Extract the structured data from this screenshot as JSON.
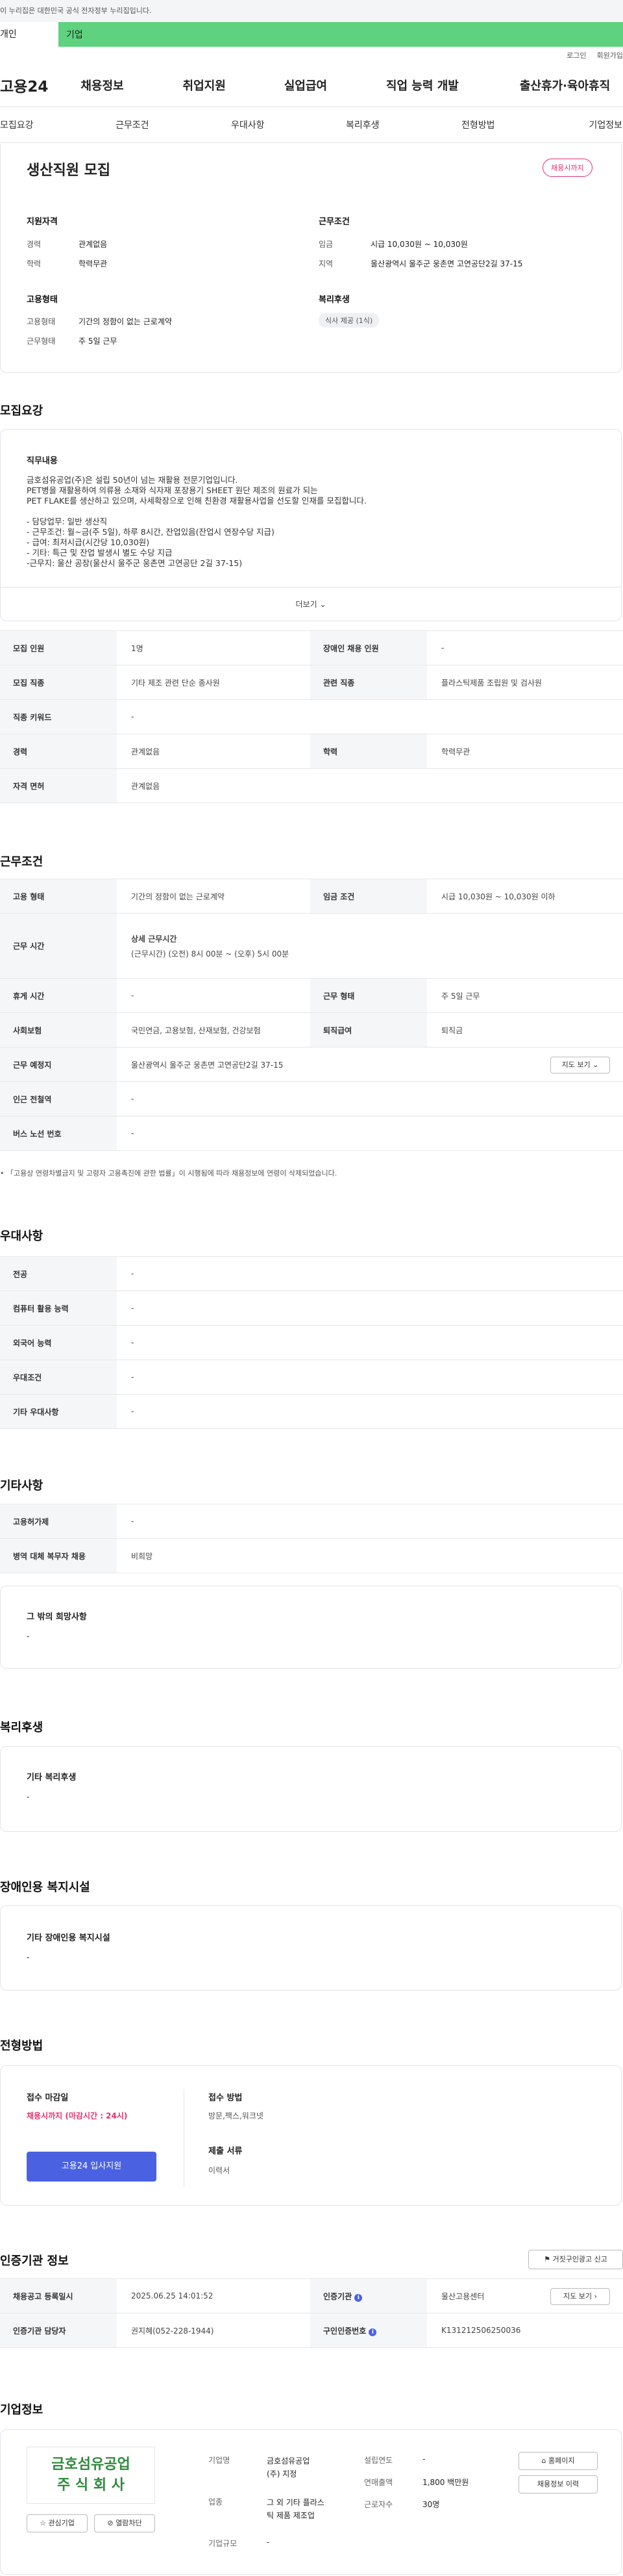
{
  "gov_notice": "이 누리집은 대한민국 공식 전자정부 누리집입니다.",
  "tabs": {
    "person": "개인",
    "company": "기업"
  },
  "util": {
    "login": "로그인",
    "join": "회원가입"
  },
  "gnb": {
    "logo": "고용24",
    "items": [
      "채용정보",
      "취업지원",
      "실업급여",
      "직업 능력 개발",
      "출산휴가·육아휴직"
    ]
  },
  "subnav": [
    "모집요강",
    "근무조건",
    "우대사항",
    "복리후생",
    "전형방법",
    "기업정보"
  ],
  "summary": {
    "title": "생산직원 모집",
    "badge": "채용시까지",
    "qual_title": "지원자격",
    "career_label": "경력",
    "career": "관계없음",
    "edu_label": "학력",
    "edu": "학력무관",
    "cond_title": "근무조건",
    "wage_label": "임금",
    "wage": "시급 10,030원 ~ 10,030원",
    "region_label": "지역",
    "region": "울산광역시 울주군 웅촌면 고연공단2길 37-15",
    "emp_title": "고용형태",
    "emp_label": "고용형태",
    "emp": "기간의 정함이 없는 근로계약",
    "work_label": "근무형태",
    "work": "주 5일 근무",
    "welfare_title": "복리후생",
    "welfare_tag": "식사 제공 (1식)"
  },
  "recruit": {
    "title": "모집요강",
    "duty_title": "직무내용",
    "lines": [
      "금호섬유공업(주)은 설립 50년이 넘는 재활용 전문기업입니다.",
      "PET병을 재활용하여 의류용 소재와 식자재 포장용기 SHEET 원단 제조의 원료가 되는",
      "PET FLAKE를 생산하고 있으며, 사세확장으로 인해 친환경 재활용사업을 선도할 인재를 모집합니다.",
      "",
      "- 담당업무: 일반 생산직",
      "- 근무조건: 월~금(주 5일), 하루 8시간, 잔업있음(잔업시 연장수당 지급)",
      "- 급여: 최저시급(시간당 10,030원)",
      "- 기타: 특근 및 잔업 발생시 별도 수당 지급",
      "-근무지: 울산 공장(울산시 울주군 웅촌면 고연공단 2길 37-15)"
    ],
    "more": "더보기",
    "rows": [
      {
        "h1": "모집 인원",
        "v1": "1명",
        "h2": "장애인 채용 인원",
        "v2": "-"
      },
      {
        "h1": "모집 직종",
        "v1": "기타 제조 관련 단순 종사원",
        "h2": "관련 직종",
        "v2": "플라스틱제품 조립원 및 검사원"
      },
      {
        "h1": "직종 키워드",
        "v1": "-"
      },
      {
        "h1": "경력",
        "v1": "관계없음",
        "h2": "학력",
        "v2": "학력무관"
      },
      {
        "h1": "자격 면허",
        "v1": "관계없음"
      }
    ]
  },
  "conditions": {
    "title": "근무조건",
    "emp_h": "고용 형태",
    "emp_v": "기간의 정함이 없는 근로계약",
    "wage_h": "임금 조건",
    "wage_v": "시급 10,030원 ~ 10,030원 이하",
    "time_h": "근무 시간",
    "time_t": "상세 근무시간",
    "time_v": "(근무시간) (오전) 8시 00분 ~ (오후) 5시 00분",
    "rest_h": "휴게 시간",
    "rest_v": "-",
    "type_h": "근무 형태",
    "type_v": "주 5일 근무",
    "ins_h": "사회보험",
    "ins_v": "국민연금, 고용보험, 산재보험, 건강보험",
    "ret_h": "퇴직급여",
    "ret_v": "퇴직금",
    "place_h": "근무 예정지",
    "place_v": "울산광역시 울주군 웅촌면 고연공단2길 37-15",
    "map_btn": "지도 보기",
    "station_h": "인근 전철역",
    "station_v": "-",
    "bus_h": "버스 노선 번호",
    "bus_v": "-",
    "note": "「고용상 연령차별금지 및 고령자 고용촉진에 관한 법률」이 시행됨에 따라 채용정보에 연령이 삭제되었습니다."
  },
  "pref": {
    "title": "우대사항",
    "rows": [
      {
        "h": "전공",
        "v": "-"
      },
      {
        "h": "컴퓨터 활용 능력",
        "v": "-"
      },
      {
        "h": "외국어 능력",
        "v": "-"
      },
      {
        "h": "우대조건",
        "v": "-"
      },
      {
        "h": "기타 우대사항",
        "v": "-"
      }
    ]
  },
  "etc": {
    "title": "기타사항",
    "rows": [
      {
        "h": "고용허가제",
        "v": "-"
      },
      {
        "h": "병역 대체 복무자 채용",
        "v": "비희망"
      }
    ],
    "wish_title": "그 밖의 희망사항",
    "wish_v": "-"
  },
  "welfare": {
    "title": "복리후생",
    "sub": "기타 복리후생",
    "v": "-"
  },
  "disabled": {
    "title": "장애인용 복지시설",
    "sub": "기타 장애인용 복지시설",
    "v": "-"
  },
  "method": {
    "title": "전형방법",
    "deadline_t": "접수 마감일",
    "deadline_v": "채용시까지 (마감시간 : 24시)",
    "apply_btn": "고용24 입사지원",
    "how_t": "접수 방법",
    "how_v": "방문,팩스,워크넷",
    "docs_t": "제출 서류",
    "docs_v": "이력서"
  },
  "agency": {
    "title": "인증기관 정보",
    "report": "거짓구인광고 신고",
    "reg_h": "채용공고 등록일시",
    "reg_v": "2025.06.25 14:01:52",
    "org_h": "인증기관",
    "org_v": "울산고용센터",
    "map_btn": "지도 보기",
    "mgr_h": "인증기관 담당자",
    "mgr_v": "권지혜(052-228-1944)",
    "num_h": "구인인증번호",
    "num_v": "K131212506250036"
  },
  "company": {
    "title": "기업정보",
    "logo1": "금호섬유공업",
    "logo2": "주 식 회 사",
    "fav": "관심기업",
    "block": "열람차단",
    "name_h": "기업명",
    "name_v": "금호섬유공업\n(주)  지정",
    "ind_h": "업종",
    "ind_v": "그 외 기타 플라스\n틱 제품 제조업",
    "size_h": "기업규모",
    "size_v": "-",
    "est_h": "설립연도",
    "est_v": "-",
    "sales_h": "연매출액",
    "sales_v": "1,800 백만원",
    "emp_h": "근로자수",
    "emp_v": "30명",
    "home_btn": "홈페이지",
    "hist_btn": "채용정보 이력"
  },
  "colors": {
    "green": "#5ed27e",
    "accent": "#e8336e",
    "blue": "#4a62e2"
  }
}
